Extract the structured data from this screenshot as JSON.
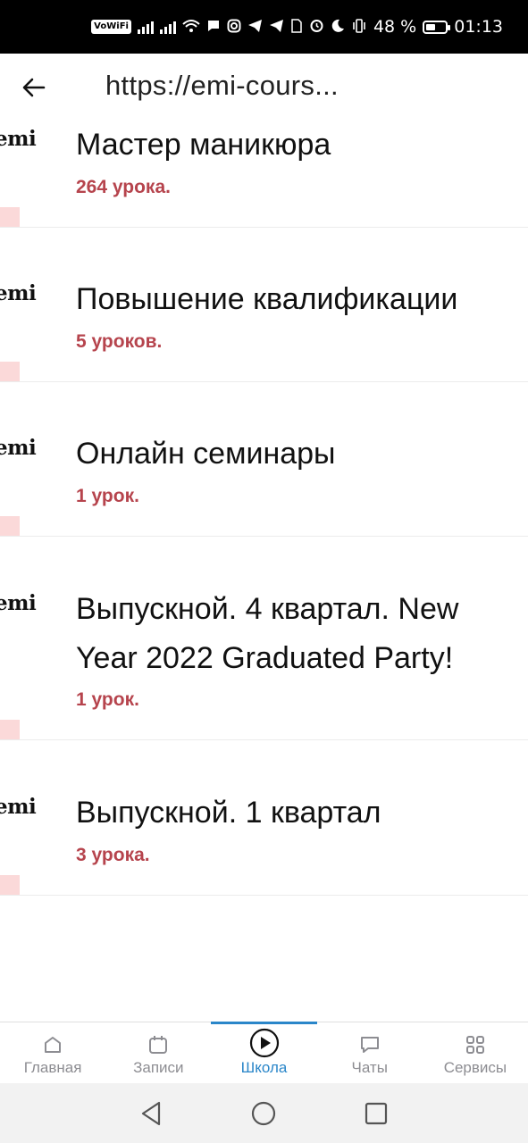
{
  "status_bar": {
    "vowifi": "VoWiFi",
    "battery_percent": "48 %",
    "time": "01:13"
  },
  "header": {
    "url": "https://emi-cours..."
  },
  "courses": [
    {
      "logo": "emi",
      "title": "Мастер маникюра",
      "lessons": "264 урока."
    },
    {
      "logo": "emi",
      "title": "Повышение квалификации",
      "lessons": "5 уроков."
    },
    {
      "logo": "emi",
      "title": "Онлайн семинары",
      "lessons": "1 урок."
    },
    {
      "logo": "emi",
      "title": "Выпускной. 4 квартал. New Year 2022 Graduated Party!",
      "lessons": "1 урок."
    },
    {
      "logo": "emi",
      "title": "Выпускной. 1 квартал",
      "lessons": "3 урока."
    }
  ],
  "tabs": [
    {
      "label": "Главная",
      "icon": "home-icon"
    },
    {
      "label": "Записи",
      "icon": "calendar-icon"
    },
    {
      "label": "Школа",
      "icon": "play-circle-icon",
      "active": true
    },
    {
      "label": "Чаты",
      "icon": "chat-bubble-icon"
    },
    {
      "label": "Сервисы",
      "icon": "grid-icon"
    }
  ],
  "colors": {
    "accent": "#2a86c9",
    "lesson_count": "#b6444d",
    "logo_tile": "#fbd9d9"
  }
}
